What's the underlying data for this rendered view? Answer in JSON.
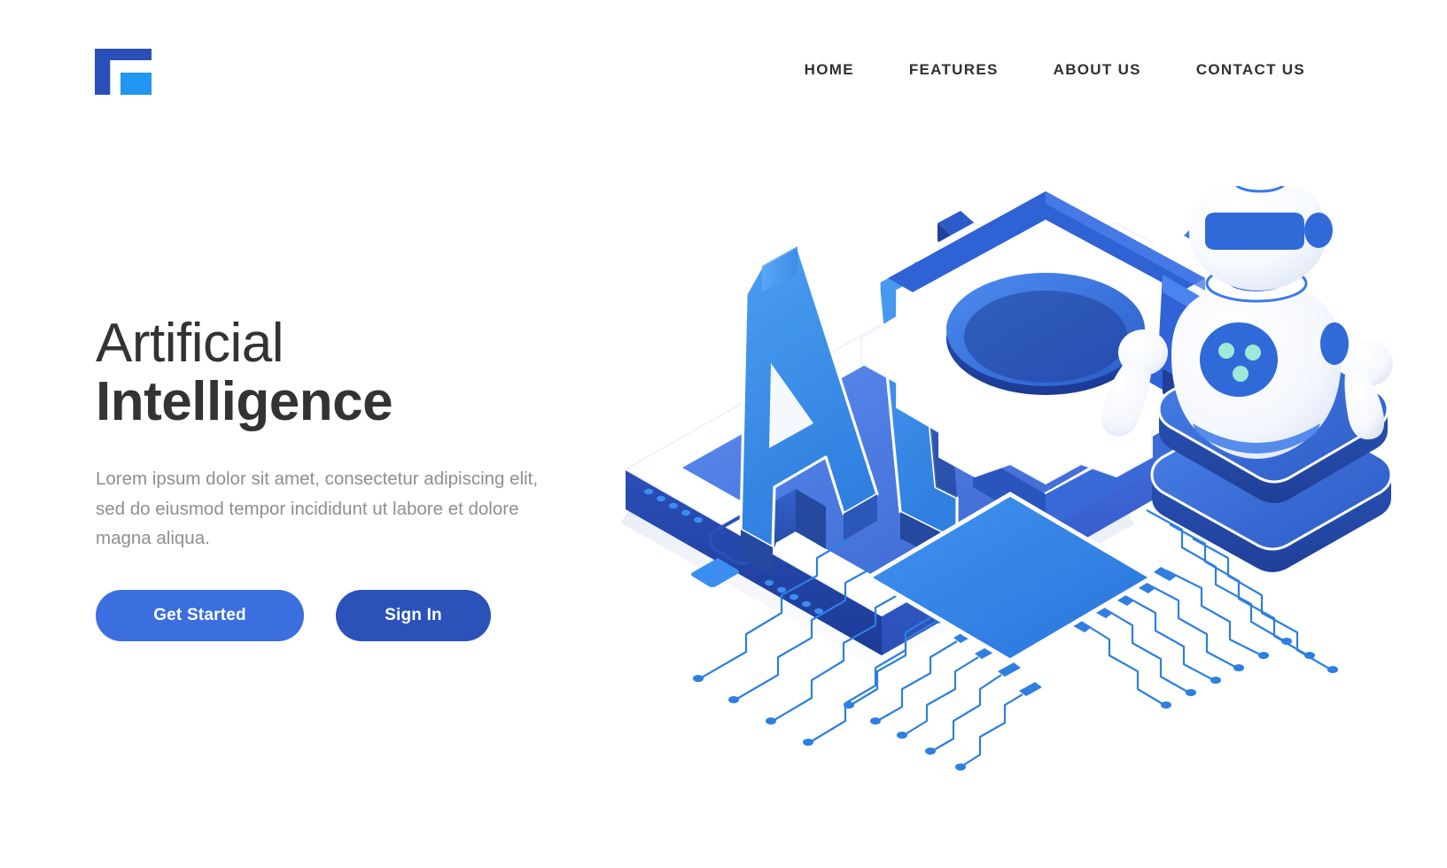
{
  "brand": {
    "logo_icon": "logo-f-mark",
    "logo_colors": {
      "outer": "#2a4fb8",
      "inner": "#2196f3"
    }
  },
  "nav": {
    "items": [
      {
        "label": "HOME"
      },
      {
        "label": "FEATURES"
      },
      {
        "label": "ABOUT US"
      },
      {
        "label": "CONTACT US"
      }
    ]
  },
  "hero": {
    "headline_line1": "Artificial",
    "headline_line2": "Intelligence",
    "paragraph": "Lorem ipsum dolor sit amet, consectetur adipiscing elit, sed do eiusmod tempor incididunt ut labore et dolore magna aliqua.",
    "buttons": {
      "primary_label": "Get Started",
      "secondary_label": "Sign In"
    }
  },
  "illustration": {
    "name": "isometric-ai-smartphone-robot-chip",
    "elements": [
      "smartphone-isometric",
      "ai-3d-text",
      "gear-3d",
      "arrow-3d",
      "robot-mascot",
      "robot-platform",
      "cpu-chip",
      "circuit-traces"
    ],
    "text_in_art": "AI"
  },
  "colors": {
    "accent_primary": "#3b6fe0",
    "accent_dark": "#2b52b8",
    "accent_light": "#2196f3",
    "text_dark": "#333333",
    "text_muted": "#8e8e93",
    "background": "#ffffff"
  }
}
